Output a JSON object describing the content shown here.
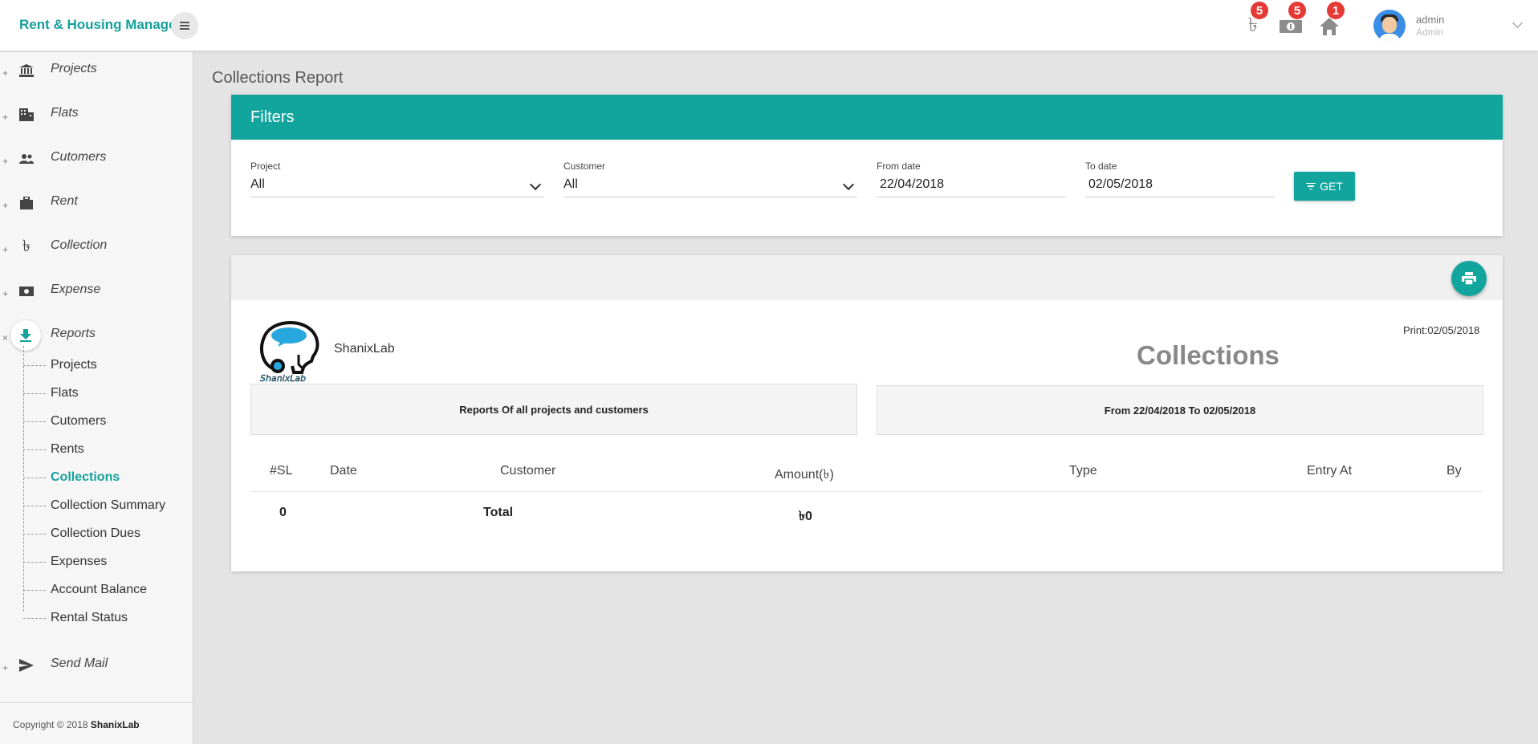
{
  "app": {
    "brand": "Rent & Housing Manage"
  },
  "topbar": {
    "notifications": [
      {
        "icon": "taka-icon",
        "badge": "5"
      },
      {
        "icon": "cash-icon",
        "badge": "5"
      },
      {
        "icon": "home-icon",
        "badge": "1"
      }
    ],
    "user": {
      "name": "admin",
      "role": "Admin"
    }
  },
  "sidebar": {
    "items": [
      {
        "label": "Projects",
        "icon": "bank-icon",
        "toggle": "+"
      },
      {
        "label": "Flats",
        "icon": "building-icon",
        "toggle": "+"
      },
      {
        "label": "Cutomers",
        "icon": "people-icon",
        "toggle": "+"
      },
      {
        "label": "Rent",
        "icon": "briefcase-icon",
        "toggle": "+"
      },
      {
        "label": "Collection",
        "icon": "taka-icon",
        "toggle": "+"
      },
      {
        "label": "Expense",
        "icon": "money-icon",
        "toggle": "+"
      },
      {
        "label": "Reports",
        "icon": "download-icon",
        "toggle": "×"
      },
      {
        "label": "Send Mail",
        "icon": "send-icon",
        "toggle": "+"
      }
    ],
    "report_items": [
      "Projects",
      "Flats",
      "Cutomers",
      "Rents",
      "Collections",
      "Collection Summary",
      "Collection Dues",
      "Expenses",
      "Account Balance",
      "Rental Status"
    ],
    "active_report": "Collections",
    "footer_prefix": "Copyright © 2018",
    "footer_company": "ShanixLab"
  },
  "page": {
    "title": "Collections Report"
  },
  "filters": {
    "heading": "Filters",
    "project_label": "Project",
    "project_value": "All",
    "customer_label": "Customer",
    "customer_value": "All",
    "from_label": "From date",
    "from_value": "22/04/2018",
    "to_label": "To date",
    "to_value": "02/05/2018",
    "get_label": "GET"
  },
  "report": {
    "company": "ShanixLab",
    "print_date": "Print:02/05/2018",
    "title": "Collections",
    "scope_text": "Reports Of all projects and customers",
    "range_text": "From 22/04/2018 To 02/05/2018",
    "columns": [
      "#SL",
      "Date",
      "Customer",
      "Amount(৳)",
      "Type",
      "Entry At",
      "By"
    ],
    "total_row": {
      "count": "0",
      "label": "Total",
      "amount": "৳0"
    }
  },
  "colors": {
    "accent": "#11a59e",
    "badge": "#e53935"
  }
}
